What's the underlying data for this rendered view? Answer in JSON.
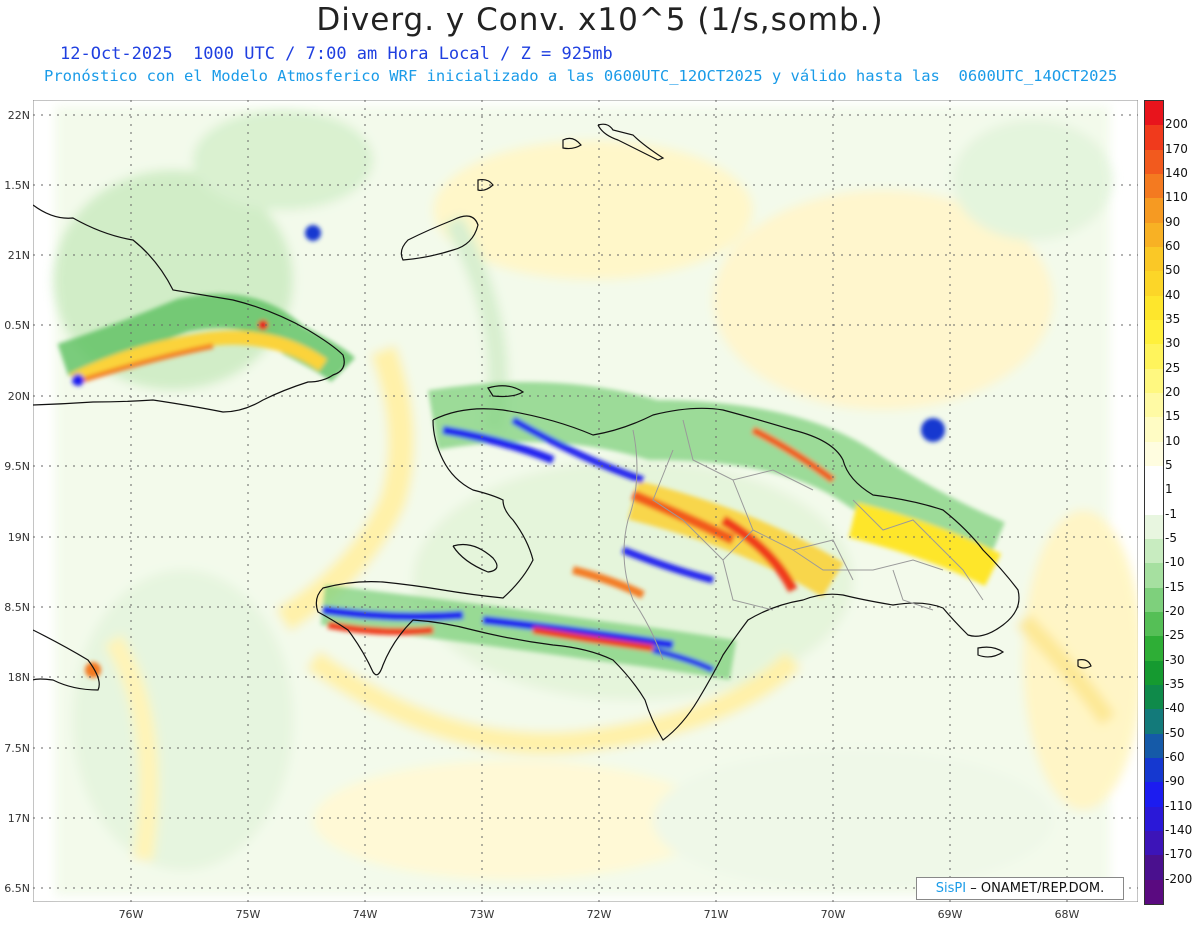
{
  "title": "Diverg. y Conv. x10^5 (1/s,somb.)",
  "subtitle_line1": "12-Oct-2025  1000 UTC / 7:00 am Hora Local / Z = 925mb",
  "subtitle_line2": "Pronóstico con el Modelo Atmosferico WRF inicializado a las 0600UTC_12OCT2025 y válido hasta las  0600UTC_14OCT2025",
  "lat_labels": [
    "22N",
    "1.5N",
    "21N",
    "0.5N",
    "20N",
    "9.5N",
    "19N",
    "8.5N",
    "18N",
    "7.5N",
    "17N",
    "6.5N"
  ],
  "lon_labels": [
    "76W",
    "75W",
    "74W",
    "73W",
    "72W",
    "71W",
    "70W",
    "69W",
    "68W"
  ],
  "colorbar": {
    "labels": [
      "200",
      "170",
      "140",
      "110",
      "90",
      "60",
      "50",
      "40",
      "35",
      "30",
      "25",
      "20",
      "15",
      "10",
      "5",
      "1",
      "-1",
      "-5",
      "-10",
      "-15",
      "-20",
      "-25",
      "-30",
      "-35",
      "-40",
      "-50",
      "-60",
      "-90",
      "-110",
      "-140",
      "-170",
      "-200"
    ],
    "colors": [
      "#e8141c",
      "#f03a1c",
      "#f25a1e",
      "#f47a20",
      "#f69a22",
      "#f8b124",
      "#fac826",
      "#fcd628",
      "#fee62c",
      "#fff03c",
      "#fff45c",
      "#fff880",
      "#fffaa4",
      "#fffcc4",
      "#fffde0",
      "#ffffff",
      "#ffffff",
      "#e8f6e0",
      "#c8ecc0",
      "#a6e0a0",
      "#7ed07c",
      "#55bf56",
      "#2eae36",
      "#159a30",
      "#0f8a4a",
      "#137a7a",
      "#155aa8",
      "#1538d0",
      "#1c1cf0",
      "#2a18d8",
      "#3c14b8",
      "#4a108e",
      "#5a0a80"
    ]
  },
  "credit": {
    "brand": "SisPI",
    "dash": "–",
    "org": "ONAMET/REP.DOM."
  },
  "colors": {
    "land_outline": "#111111",
    "province_border": "#9a9a9a",
    "grid": "#666666"
  }
}
